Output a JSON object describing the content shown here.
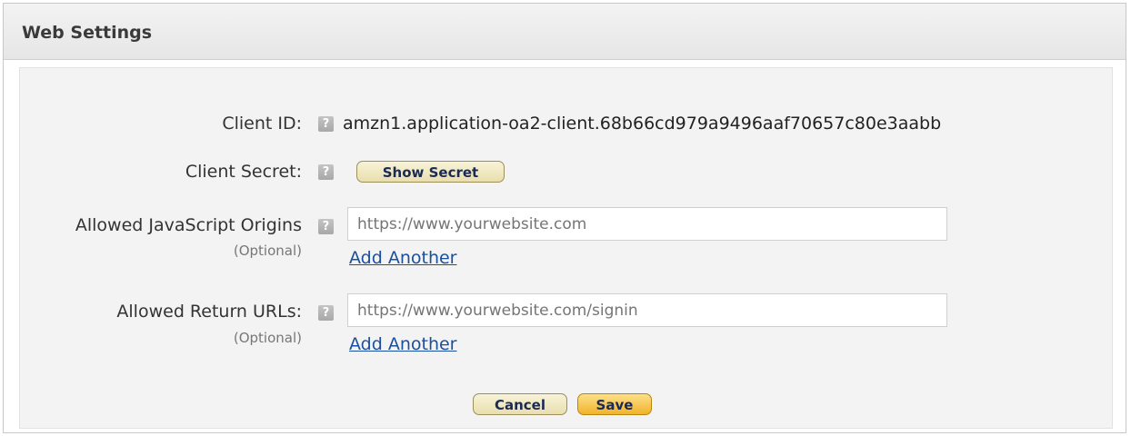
{
  "panel": {
    "title": "Web Settings"
  },
  "fields": {
    "client_id": {
      "label": "Client ID:",
      "help_icon": "question-icon",
      "value": "amzn1.application-oa2-client.68b66cd979a9496aaf70657c80e3aabb"
    },
    "client_secret": {
      "label": "Client Secret:",
      "help_icon": "question-icon",
      "button_label": "Show Secret"
    },
    "js_origins": {
      "label": "Allowed JavaScript Origins",
      "optional": "(Optional)",
      "help_icon": "question-icon",
      "placeholder": "https://www.yourwebsite.com",
      "value": "",
      "add_link": "Add Another"
    },
    "return_urls": {
      "label": "Allowed Return URLs:",
      "optional": "(Optional)",
      "help_icon": "question-icon",
      "placeholder": "https://www.yourwebsite.com/signin",
      "value": "",
      "add_link": "Add Another"
    }
  },
  "actions": {
    "cancel_label": "Cancel",
    "save_label": "Save"
  },
  "colors": {
    "link": "#1a4fa0",
    "save_button": "#f2b32a",
    "default_button": "#e8deae"
  }
}
